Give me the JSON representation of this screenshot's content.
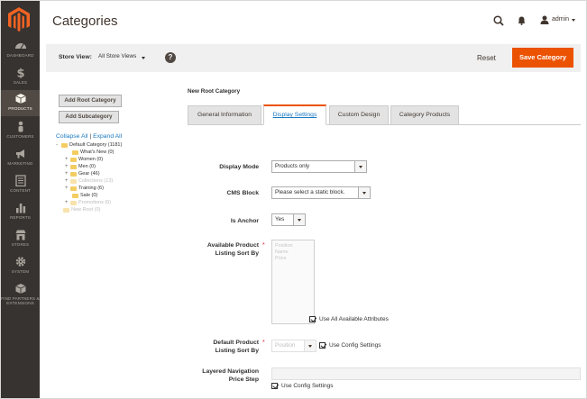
{
  "sidebar": {
    "items": [
      {
        "label": "DASHBOARD",
        "icon": "dashboard-icon"
      },
      {
        "label": "SALES",
        "icon": "dollar-icon"
      },
      {
        "label": "PRODUCTS",
        "icon": "cube-icon"
      },
      {
        "label": "CUSTOMERS",
        "icon": "person-icon"
      },
      {
        "label": "MARKETING",
        "icon": "megaphone-icon"
      },
      {
        "label": "CONTENT",
        "icon": "layout-icon"
      },
      {
        "label": "REPORTS",
        "icon": "bar-chart-icon"
      },
      {
        "label": "STORES",
        "icon": "store-icon"
      },
      {
        "label": "SYSTEM",
        "icon": "gear-icon"
      },
      {
        "label": "FIND PARTNERS & EXTENSIONS",
        "icon": "box-icon"
      }
    ],
    "active_index": 2
  },
  "header": {
    "title": "Categories",
    "user": "admin"
  },
  "store_bar": {
    "label": "Store View:",
    "value": "All Store Views",
    "help": "?",
    "reset": "Reset",
    "save": "Save Category"
  },
  "tree": {
    "add_root": "Add Root Category",
    "add_sub": "Add Subcategory",
    "collapse": "Collapse All",
    "separator": "|",
    "expand": "Expand All",
    "nodes": [
      {
        "label": "Default Category (1181)",
        "pm": "-",
        "dim": false
      },
      {
        "label": "What's New (0)",
        "pm": "",
        "dim": false
      },
      {
        "label": "Women (0)",
        "pm": "+",
        "dim": false
      },
      {
        "label": "Men (0)",
        "pm": "+",
        "dim": false
      },
      {
        "label": "Gear (46)",
        "pm": "+",
        "dim": false
      },
      {
        "label": "Collections (13)",
        "pm": "+",
        "dim": true
      },
      {
        "label": "Training (6)",
        "pm": "+",
        "dim": false
      },
      {
        "label": "Sale (0)",
        "pm": "",
        "dim": false
      },
      {
        "label": "Promotions (6)",
        "pm": "+",
        "dim": true
      },
      {
        "label": "New Root (0)",
        "pm": "",
        "dim": true
      }
    ]
  },
  "main": {
    "heading": "New Root Category",
    "tabs": [
      "General Information",
      "Display Settings",
      "Custom Design",
      "Category Products"
    ],
    "active_tab": 1,
    "fields": {
      "display_mode_label": "Display Mode",
      "display_mode_value": "Products only",
      "cms_block_label": "CMS Block",
      "cms_block_value": "Please select a static block.",
      "is_anchor_label": "Is Anchor",
      "is_anchor_value": "Yes",
      "sort_by_label_1": "Available Product",
      "sort_by_label_2": "Listing Sort By",
      "sort_by_options": [
        "Position",
        "Name",
        "Price"
      ],
      "use_all_label": "Use All Available Attributes",
      "default_sort_label_1": "Default Product",
      "default_sort_label_2": "Listing Sort By",
      "default_sort_value": "Position",
      "use_config_label": "Use Config Settings",
      "layered_label_1": "Layered Navigation",
      "layered_label_2": "Price Step",
      "use_config_label_2": "Use Config Settings",
      "required_mark": "*"
    }
  },
  "colors": {
    "sidebar_bg": "#373330",
    "accent": "#eb5202",
    "link": "#1979c3"
  }
}
